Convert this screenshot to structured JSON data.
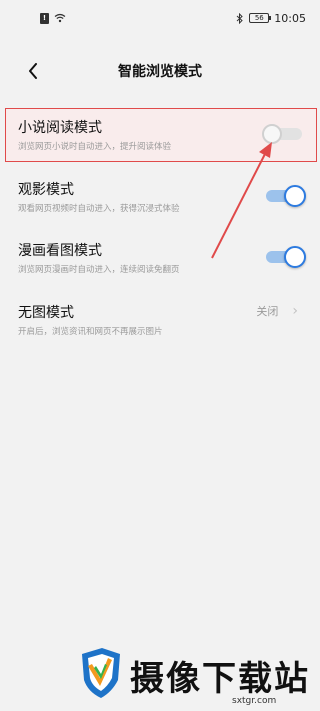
{
  "status_bar": {
    "time": "10:05",
    "battery": "56",
    "sim_badge": "!"
  },
  "header": {
    "title": "智能浏览模式"
  },
  "settings": [
    {
      "title": "小说阅读模式",
      "desc": "浏览网页小说时自动进入，提升阅读体验",
      "state": "off"
    },
    {
      "title": "观影模式",
      "desc": "观看网页视频时自动进入，获得沉浸式体验",
      "state": "on"
    },
    {
      "title": "漫画看图模式",
      "desc": "浏览网页漫画时自动进入，连续阅读免翻页",
      "state": "on"
    },
    {
      "title": "无图模式",
      "desc": "开启后，浏览资讯和网页不再展示图片",
      "value": "关闭"
    }
  ],
  "watermark": {
    "brand": "摄像下载站",
    "domain": "sxtgr.com"
  },
  "colors": {
    "accent": "#2d7be0",
    "highlight": "#e04a4a"
  }
}
